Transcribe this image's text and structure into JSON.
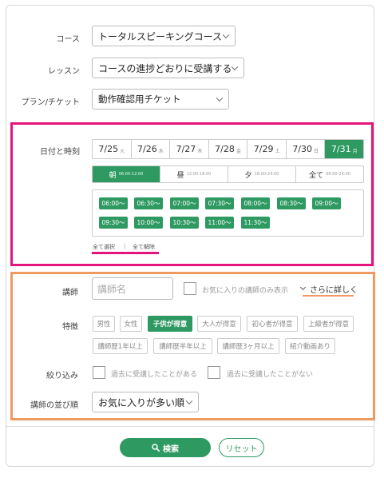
{
  "course": {
    "label": "コース",
    "value": "トータルスピーキングコース"
  },
  "lesson": {
    "label": "レッスン",
    "value": "コースの進捗どおりに受講する"
  },
  "plan": {
    "label": "プラン/チケット",
    "value": "動作確認用チケット"
  },
  "schedule": {
    "label": "日付と時刻",
    "dates": [
      {
        "date": "7/25",
        "weekday": "火"
      },
      {
        "date": "7/26",
        "weekday": "水"
      },
      {
        "date": "7/27",
        "weekday": "木"
      },
      {
        "date": "7/28",
        "weekday": "金"
      },
      {
        "date": "7/29",
        "weekday": "土"
      },
      {
        "date": "7/30",
        "weekday": "日"
      },
      {
        "date": "7/31",
        "weekday": "月",
        "active": true
      }
    ],
    "periods": [
      {
        "name": "朝",
        "time": "06:00-12:00",
        "active": true
      },
      {
        "name": "昼",
        "time": "12:00-18:00"
      },
      {
        "name": "夕",
        "time": "18:00-24:00"
      },
      {
        "name": "全て",
        "time": "06:00-24:00"
      }
    ],
    "slots": [
      "06:00〜",
      "06:30〜",
      "07:00〜",
      "07:30〜",
      "08:00〜",
      "08:30〜",
      "09:00〜",
      "09:30〜",
      "10:00〜",
      "10:30〜",
      "11:00〜",
      "11:30〜"
    ],
    "select_all": "全て選択",
    "separator": "|",
    "clear_all": "全て解除"
  },
  "teacher": {
    "label": "講師",
    "placeholder": "講師名",
    "favorites_only": "お気に入りの講師のみ表示",
    "more_link": "さらに詳しく"
  },
  "features": {
    "label": "特徴",
    "tags": [
      {
        "text": "男性"
      },
      {
        "text": "女性"
      },
      {
        "text": "子供が得意",
        "active": true
      },
      {
        "text": "大人が得意"
      },
      {
        "text": "初心者が得意"
      },
      {
        "text": "上級者が得意"
      },
      {
        "text": "講師歴1年以上"
      },
      {
        "text": "講師歴半年以上"
      },
      {
        "text": "講師歴3ヶ月以上"
      },
      {
        "text": "紹介動画あり"
      }
    ]
  },
  "filter": {
    "label": "絞り込み",
    "past_taken": "過去に受講したことがある",
    "never_taken": "過去に受講したことがない"
  },
  "sort": {
    "label": "講師の並び順",
    "value": "お気に入りが多い順"
  },
  "actions": {
    "search": "検索",
    "reset": "リセット"
  },
  "colors": {
    "accent_green": "#2e9a62",
    "highlight_pink": "#e4147c",
    "highlight_orange": "#f09a63"
  }
}
